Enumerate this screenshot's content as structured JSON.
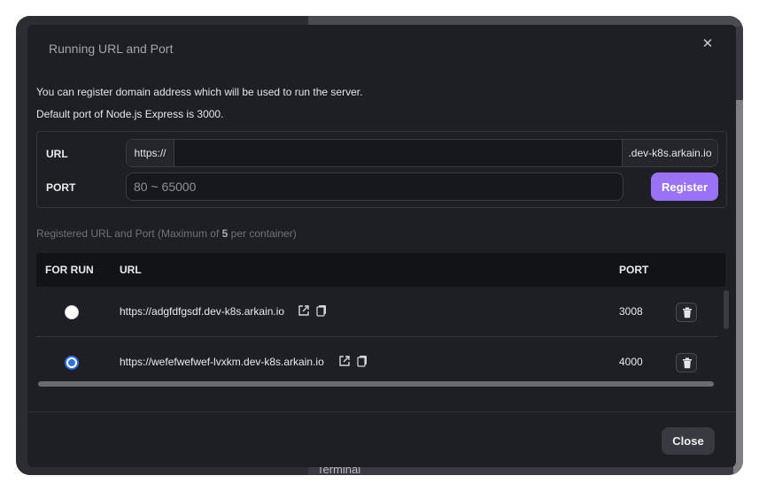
{
  "modal": {
    "title": "Running URL and Port",
    "close_icon": "close-icon",
    "description_line1": "You can register domain address which will be used to run the server.",
    "description_line2": "Default port of Node.js Express is 3000."
  },
  "form": {
    "url_label": "URL",
    "url_prefix": "https://",
    "url_value": "",
    "url_suffix": ".dev-k8s.arkain.io",
    "port_label": "PORT",
    "port_placeholder": "80 ~ 65000",
    "register_label": "Register"
  },
  "registered": {
    "note_prefix": "Registered URL and Port (Maximum of ",
    "note_max": "5",
    "note_suffix": " per container)"
  },
  "table": {
    "headers": {
      "for_run": "FOR RUN",
      "url": "URL",
      "port": "PORT"
    },
    "rows": [
      {
        "url": "https://adgfdfgsdf.dev-k8s.arkain.io",
        "port": "3008",
        "selected": false
      },
      {
        "url": "https://wefefwefwef-lvxkm.dev-k8s.arkain.io",
        "port": "4000",
        "selected": true
      }
    ]
  },
  "footer": {
    "close_label": "Close"
  },
  "background": {
    "bottom_label": "Terminal"
  },
  "colors": {
    "accent": "#9a72f5",
    "radio_selected": "#2f6fe0",
    "modal_bg": "#1e1f25"
  }
}
